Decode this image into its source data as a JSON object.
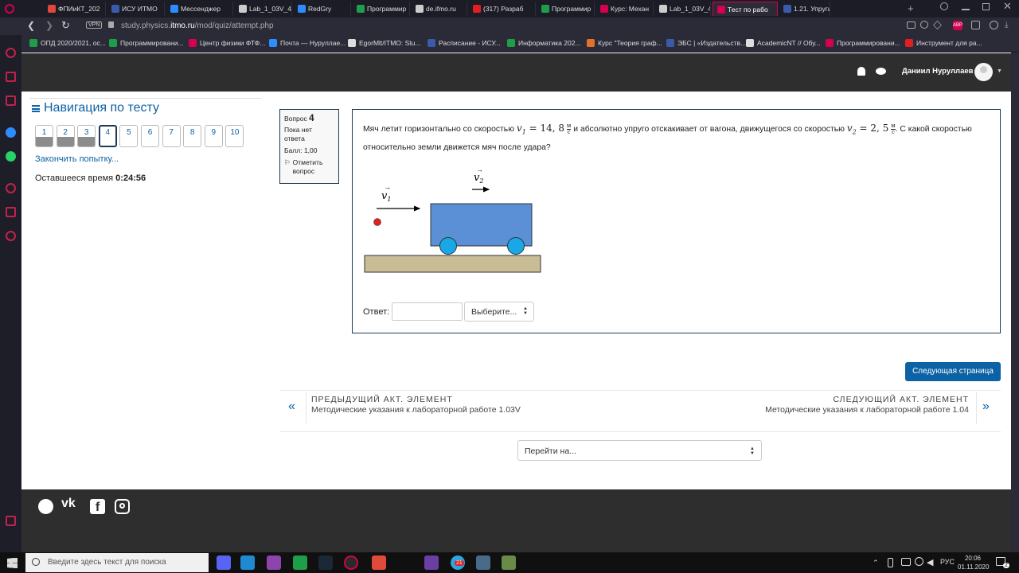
{
  "browser": {
    "tabs": [
      {
        "label": "ФПИиКТ_202",
        "color": "#e0463a"
      },
      {
        "label": "ИСУ ИТМО",
        "color": "#3b5ba9"
      },
      {
        "label": "Мессенджер",
        "color": "#2d8cff"
      },
      {
        "label": "Lab_1_03V_4(",
        "color": "#cccccc"
      },
      {
        "label": "RedGry",
        "color": "#2d8cff"
      },
      {
        "label": "Программир",
        "color": "#1e9e4a"
      },
      {
        "label": "de.ifmo.ru",
        "color": "#cccccc"
      },
      {
        "label": "(317) Разраб",
        "color": "#e02020"
      },
      {
        "label": "Программир",
        "color": "#1e9e4a"
      },
      {
        "label": "Курс: Механ",
        "color": "#d6004f"
      },
      {
        "label": "Lab_1_03V_4(",
        "color": "#cccccc"
      },
      {
        "label": "Тест по рабо",
        "color": "#d6004f",
        "active": true
      },
      {
        "label": "1.21. Упругие",
        "color": "#3b5ba9"
      }
    ],
    "url_host": "study.physics.",
    "url_domain": "itmo.ru",
    "url_path": "/mod/quiz/attempt.php",
    "vpn_label": "VPN",
    "bookmarks": [
      {
        "label": "ОПД 2020/2021, ос...",
        "color": "#1e9e4a"
      },
      {
        "label": "Программировани...",
        "color": "#1e9e4a"
      },
      {
        "label": "Центр физики ФТФ...",
        "color": "#d6004f"
      },
      {
        "label": "Почта — Нуруллае...",
        "color": "#2d8cff"
      },
      {
        "label": "EgorMlt/ITMO: Stu...",
        "color": "#dddddd"
      },
      {
        "label": "Расписание - ИСУ...",
        "color": "#3b5ba9"
      },
      {
        "label": "Информатика 202...",
        "color": "#1e9e4a"
      },
      {
        "label": "Курс \"Теория граф...",
        "color": "#e2712a"
      },
      {
        "label": "ЭБС | «Издательств...",
        "color": "#3b5ba9"
      },
      {
        "label": "AcademicNT // Обу...",
        "color": "#dddddd"
      },
      {
        "label": "Программировани...",
        "color": "#d6004f"
      },
      {
        "label": "Инструмент для ра...",
        "color": "#e02020"
      }
    ]
  },
  "header": {
    "user_name": "Даниил Нуруллаев"
  },
  "nav": {
    "title": "Навигация по тесту",
    "questions": [
      {
        "num": "1",
        "answered": true
      },
      {
        "num": "2",
        "answered": true
      },
      {
        "num": "3",
        "answered": true
      },
      {
        "num": "4",
        "current": true
      },
      {
        "num": "5"
      },
      {
        "num": "6"
      },
      {
        "num": "7"
      },
      {
        "num": "8"
      },
      {
        "num": "9"
      },
      {
        "num": "10"
      }
    ],
    "finish_link": "Закончить попытку...",
    "time_label": "Оставшееся время",
    "time_value": "0:24:56"
  },
  "question_info": {
    "label": "Вопрос",
    "number": "4",
    "status": "Пока нет ответа",
    "score": "Балл: 1,00",
    "flag": "Отметить вопрос"
  },
  "question": {
    "text_a": "Мяч летит горизонтально  со скоростью",
    "v1_sym": "v",
    "v1_sub": "1",
    "v1_value": "= 14, 8",
    "unit_num": "м",
    "unit_den": "с",
    "text_b": "и абсолютно упруго отскакивает от вагона, движущегося со скоростью",
    "v2_sym": "v",
    "v2_sub": "2",
    "v2_value": "= 2, 5",
    "text_c": ". С какой",
    "text_d": "скоростью относительно земли движется мяч после удара?",
    "answer_label": "Ответ:",
    "answer_value": "",
    "select_value": "Выберите..."
  },
  "figure": {
    "label_v1": "v",
    "label_v1_sub": "1",
    "label_v2": "v",
    "label_v2_sub": "2",
    "colors": {
      "ball": "#e31e24",
      "wagon": "#5b8fd6",
      "wheels": "#18a8e8",
      "ground": "#c9bd96"
    }
  },
  "next_page_button": "Следующая страница",
  "activity_nav": {
    "prev_title": "ПРЕДЫДУЩИЙ АКТ. ЭЛЕМЕНТ",
    "prev_link": "Методические указания к лабораторной работе 1.03V",
    "next_title": "СЛЕДУЮЩИЙ АКТ. ЭЛЕМЕНТ",
    "next_link": "Методические указания к лабораторной работе 1.04",
    "jump_label": "Перейти на..."
  },
  "taskbar": {
    "search_placeholder": "Введите здесь текст для поиска",
    "lang": "РУС",
    "time": "20:06",
    "date": "01.11.2020",
    "notif_count": "2",
    "telegram_badge": "21"
  }
}
